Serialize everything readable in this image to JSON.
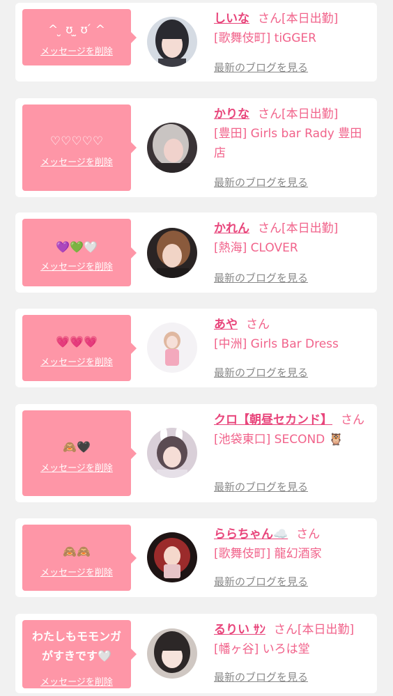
{
  "colors": {
    "accent": "#fe96a7",
    "link": "#f1638b",
    "muted": "#8a8a8a"
  },
  "delete_label": "メッセージを削除",
  "blog_label": "最新のブログを見る",
  "cards": [
    {
      "message": "^ ̮ ʊ ̫ ʊ ́ ^",
      "name": "しいな",
      "san": "さん",
      "status": "[本日出勤]",
      "area": "[歌舞伎町]",
      "shop": "tiGGER"
    },
    {
      "message": "♡♡♡♡♡",
      "name": "かりな",
      "san": "さん",
      "status": "[本日出勤]",
      "area": "[豊田]",
      "shop": "Girls bar Rady 豊田店"
    },
    {
      "message": "💜💚🤍",
      "name": "かれん",
      "san": "さん",
      "status": "[本日出勤]",
      "area": "[熱海]",
      "shop": "CLOVER"
    },
    {
      "message": "💗💗💗",
      "name": "あや",
      "san": "さん",
      "status": "",
      "area": "[中洲]",
      "shop": "Girls Bar Dress"
    },
    {
      "message": "🙈🖤",
      "name": "クロ【朝昼セカンド】",
      "san": "さん",
      "status": "",
      "area": "[池袋東口]",
      "shop": "SECOND 🦉"
    },
    {
      "message": "🙈🙈",
      "name": "ららちゃん☁️",
      "san": "さん",
      "status": "",
      "area": "[歌舞伎町]",
      "shop": "龍幻酒家"
    },
    {
      "message": "わたしもモモンガがすきです🤍",
      "name": "るりい ｻﾝ",
      "san": "さん",
      "status": "[本日出勤]",
      "area": "[幡ヶ谷]",
      "shop": "いろは堂"
    }
  ]
}
